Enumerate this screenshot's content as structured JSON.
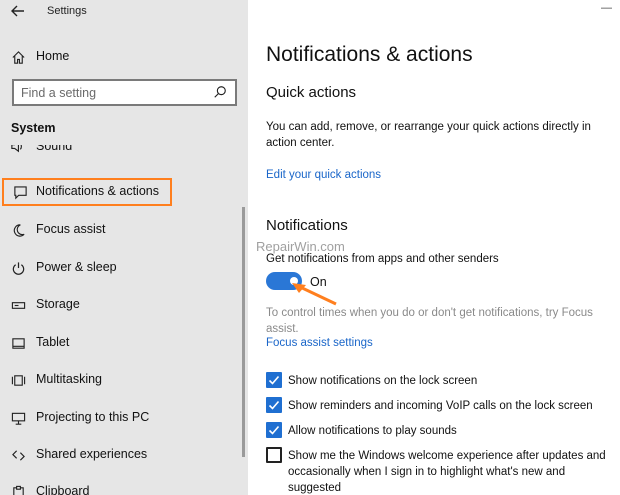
{
  "window": {
    "title": "Settings",
    "minimize_glyph": "—"
  },
  "sidebar": {
    "back_icon": "back-arrow-icon",
    "home_label": "Home",
    "search_placeholder": "Find a setting",
    "section_label": "System",
    "items": [
      {
        "label": "Sound",
        "icon": "speaker-icon"
      },
      {
        "label": "Notifications & actions",
        "icon": "message-icon",
        "selected": true
      },
      {
        "label": "Focus assist",
        "icon": "moon-icon"
      },
      {
        "label": "Power & sleep",
        "icon": "power-icon"
      },
      {
        "label": "Storage",
        "icon": "drive-icon"
      },
      {
        "label": "Tablet",
        "icon": "tablet-icon"
      },
      {
        "label": "Multitasking",
        "icon": "multitasking-icon"
      },
      {
        "label": "Projecting to this PC",
        "icon": "projecting-icon"
      },
      {
        "label": "Shared experiences",
        "icon": "shared-icon"
      },
      {
        "label": "Clipboard",
        "icon": "clipboard-icon"
      }
    ]
  },
  "main": {
    "title": "Notifications & actions",
    "quick_actions": {
      "heading": "Quick actions",
      "description_line1": "You can add, remove, or rearrange your quick actions directly in",
      "description_line2": "action center.",
      "link": "Edit your quick actions"
    },
    "notifications": {
      "heading": "Notifications",
      "toggle_label": "Get notifications from apps and other senders",
      "toggle_state": "On",
      "toggle_on": true,
      "hint_line1": "To control times when you do or don't get notifications, try Focus",
      "hint_line2": "assist.",
      "focus_link": "Focus assist settings",
      "checkboxes": [
        {
          "label": "Show notifications on the lock screen",
          "checked": true
        },
        {
          "label": "Show reminders and incoming VoIP calls on the lock screen",
          "checked": true
        },
        {
          "label": "Allow notifications to play sounds",
          "checked": true
        },
        {
          "label": "Show me the Windows welcome experience after updates and occasionally when I sign in to highlight what's new and suggested",
          "checked": false
        }
      ]
    },
    "watermark": "RepairWin.com"
  },
  "colors": {
    "accent": "#1f6fd1",
    "highlight": "#ff7f1e",
    "sidebar_bg": "#e6e6e6"
  }
}
